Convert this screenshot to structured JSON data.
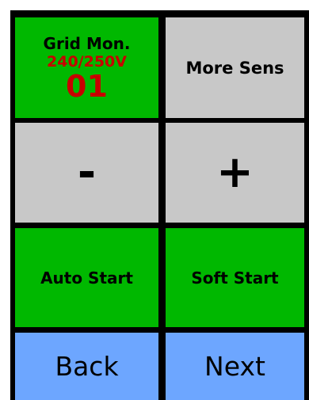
{
  "grid_monitor": {
    "title": "Grid Mon.",
    "voltage": "240/250V",
    "value": "01"
  },
  "buttons": {
    "more_sens": "More Sens",
    "minus": "-",
    "plus": "+",
    "auto_start": "Auto Start",
    "soft_start": "Soft Start",
    "back": "Back",
    "next": "Next"
  },
  "colors": {
    "active": "#00b800",
    "inactive": "#c8c8c8",
    "nav": "#6da6ff",
    "value_text": "#c80000",
    "background": "#000000"
  }
}
